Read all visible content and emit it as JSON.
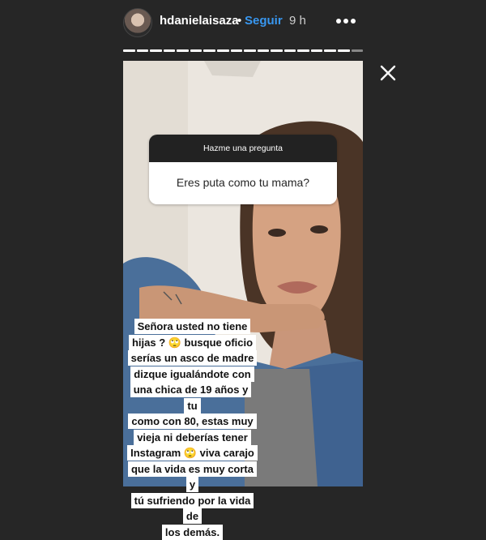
{
  "header": {
    "username": "hdanielaisaza",
    "separator": "•",
    "follow_label": "Seguir",
    "time": "9 h"
  },
  "progress": {
    "segments": 18,
    "current": 17
  },
  "question": {
    "title": "Hazme una pregunta",
    "text": "Eres puta como tu mama?"
  },
  "reply": {
    "lines": [
      "Señora usted no tiene",
      "hijas ? 🙄 busque oficio",
      "serías un asco de madre",
      "dizque igualándote con",
      "una chica de 19 años y tu",
      "como con 80, estas muy",
      "vieja ni deberías tener",
      "Instagram 🙄 viva carajo",
      "que la vida es muy corta y",
      "tú sufriendo por la vida de",
      "los demás."
    ]
  },
  "icons": {
    "more": "more-horizontal-icon",
    "close": "close-icon"
  },
  "colors": {
    "background": "#262626",
    "link": "#3897f0",
    "sticker_header": "#222222"
  }
}
